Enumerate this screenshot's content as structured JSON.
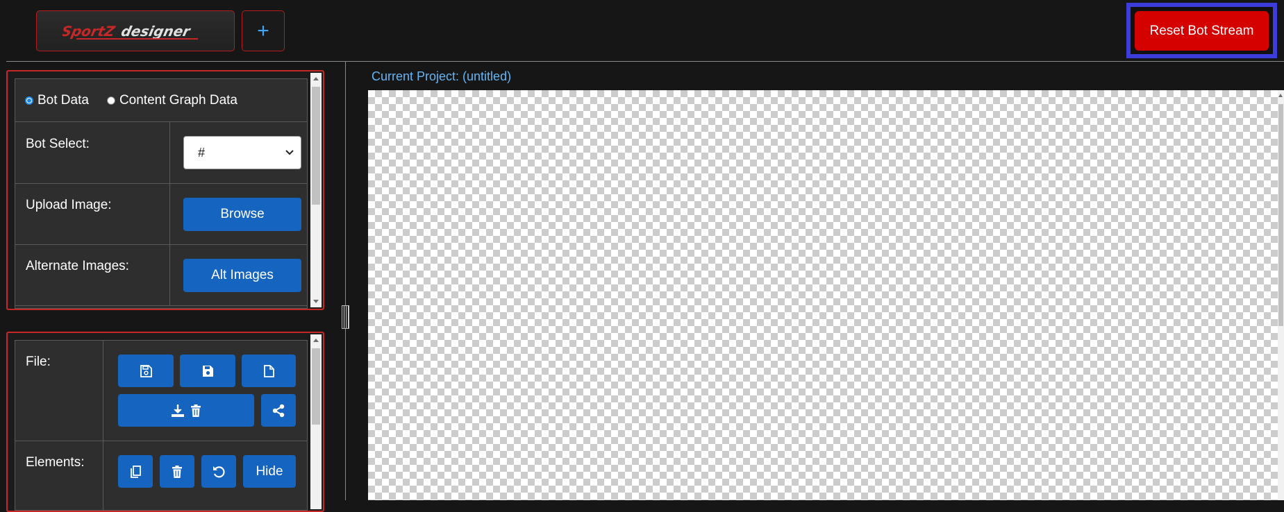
{
  "header": {
    "logo_text": "SportZdesigner",
    "add_button_label": "+",
    "reset_button_label": "Reset Bot Stream"
  },
  "data_panel": {
    "radio_options": [
      {
        "label": "Bot Data",
        "checked": true
      },
      {
        "label": "Content Graph Data",
        "checked": false
      }
    ],
    "bot_select": {
      "label": "Bot Select:",
      "value": "#"
    },
    "upload_image": {
      "label": "Upload Image:",
      "button_label": "Browse"
    },
    "alternate_images": {
      "label": "Alternate Images:",
      "button_label": "Alt Images"
    }
  },
  "tools_panel": {
    "file": {
      "label": "File:",
      "icons": [
        "save-as-icon",
        "save-icon",
        "new-file-icon",
        "download-delete-icon",
        "share-icon"
      ]
    },
    "elements": {
      "label": "Elements:",
      "icons": [
        "copy-icon",
        "trash-icon",
        "undo-icon"
      ],
      "hide_label": "Hide"
    }
  },
  "canvas": {
    "project_label": "Current Project: (untitled)"
  },
  "colors": {
    "accent_blue": "#1565c0",
    "danger_red": "#d50000",
    "panel_border": "#c62828",
    "highlight_outline": "#3d3ddb",
    "link_blue": "#64b5f6"
  }
}
